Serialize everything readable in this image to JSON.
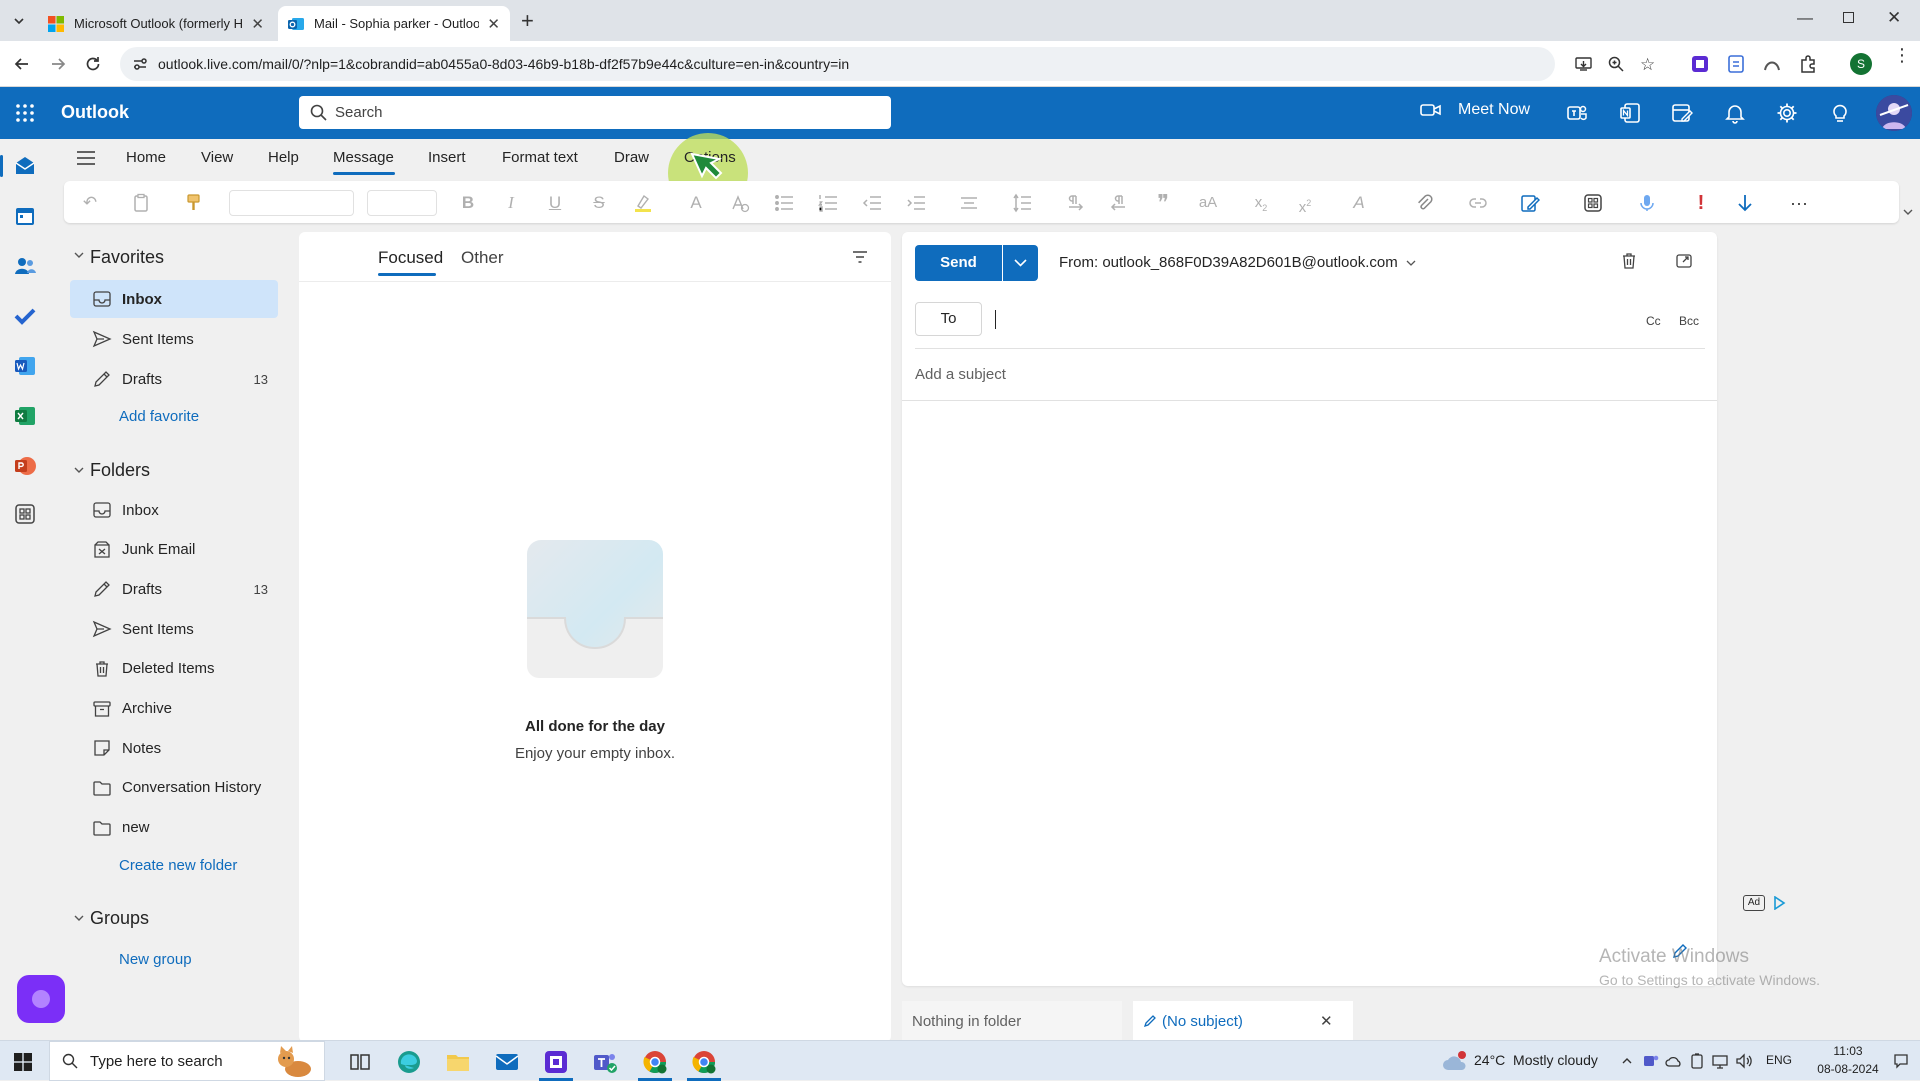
{
  "browser": {
    "tabs": [
      {
        "title": "Microsoft Outlook (formerly Ho",
        "active": false
      },
      {
        "title": "Mail - Sophia parker - Outlook",
        "active": true
      }
    ],
    "url": "outlook.live.com/mail/0/?nlp=1&cobrandid=ab0455a0-8d03-46b9-b18b-df2f57b9e44c&culture=en-in&country=in",
    "profile_initial": "S"
  },
  "header": {
    "app_name": "Outlook",
    "search_placeholder": "Search",
    "meet_now": "Meet Now"
  },
  "menu": {
    "tabs": [
      "Home",
      "View",
      "Help",
      "Message",
      "Insert",
      "Format text",
      "Draw",
      "Options"
    ],
    "active": "Message"
  },
  "folder_pane": {
    "favorites_label": "Favorites",
    "favorites": [
      {
        "label": "Inbox",
        "icon": "inbox-icon",
        "count": "",
        "selected": true
      },
      {
        "label": "Sent Items",
        "icon": "send-icon",
        "count": ""
      },
      {
        "label": "Drafts",
        "icon": "pencil-icon",
        "count": "13"
      }
    ],
    "add_favorite": "Add favorite",
    "folders_label": "Folders",
    "folders": [
      {
        "label": "Inbox",
        "icon": "inbox-icon",
        "count": ""
      },
      {
        "label": "Junk Email",
        "icon": "junk-icon",
        "count": ""
      },
      {
        "label": "Drafts",
        "icon": "pencil-icon",
        "count": "13"
      },
      {
        "label": "Sent Items",
        "icon": "send-icon",
        "count": ""
      },
      {
        "label": "Deleted Items",
        "icon": "trash-icon",
        "count": ""
      },
      {
        "label": "Archive",
        "icon": "archive-icon",
        "count": ""
      },
      {
        "label": "Notes",
        "icon": "note-icon",
        "count": ""
      },
      {
        "label": "Conversation History",
        "icon": "folder-icon",
        "count": ""
      },
      {
        "label": "new",
        "icon": "folder-icon",
        "count": ""
      }
    ],
    "create_folder": "Create new folder",
    "groups_label": "Groups",
    "new_group": "New group"
  },
  "message_list": {
    "tab_focused": "Focused",
    "tab_other": "Other",
    "empty_title": "All done for the day",
    "empty_subtitle": "Enjoy your empty inbox."
  },
  "compose": {
    "send": "Send",
    "from": "From: outlook_868F0D39A82D601B@outlook.com",
    "to_label": "To",
    "cc": "Cc",
    "bcc": "Bcc",
    "subject_placeholder": "Add a subject",
    "ad_label": "Ad"
  },
  "watermark": {
    "line1": "Activate Windows",
    "line2": "Go to Settings to activate Windows."
  },
  "bottom_tabs": {
    "nothing": "Nothing in folder",
    "draft": "(No subject)"
  },
  "taskbar": {
    "search_placeholder": "Type here to search",
    "weather": "24°C  Mostly cloudy",
    "lang": "ENG",
    "time": "11:03",
    "date": "08-08-2024"
  },
  "colors": {
    "brand": "#0f6cbd",
    "selected": "#cfe4fa",
    "cursor_highlight": "#c8e86a"
  }
}
